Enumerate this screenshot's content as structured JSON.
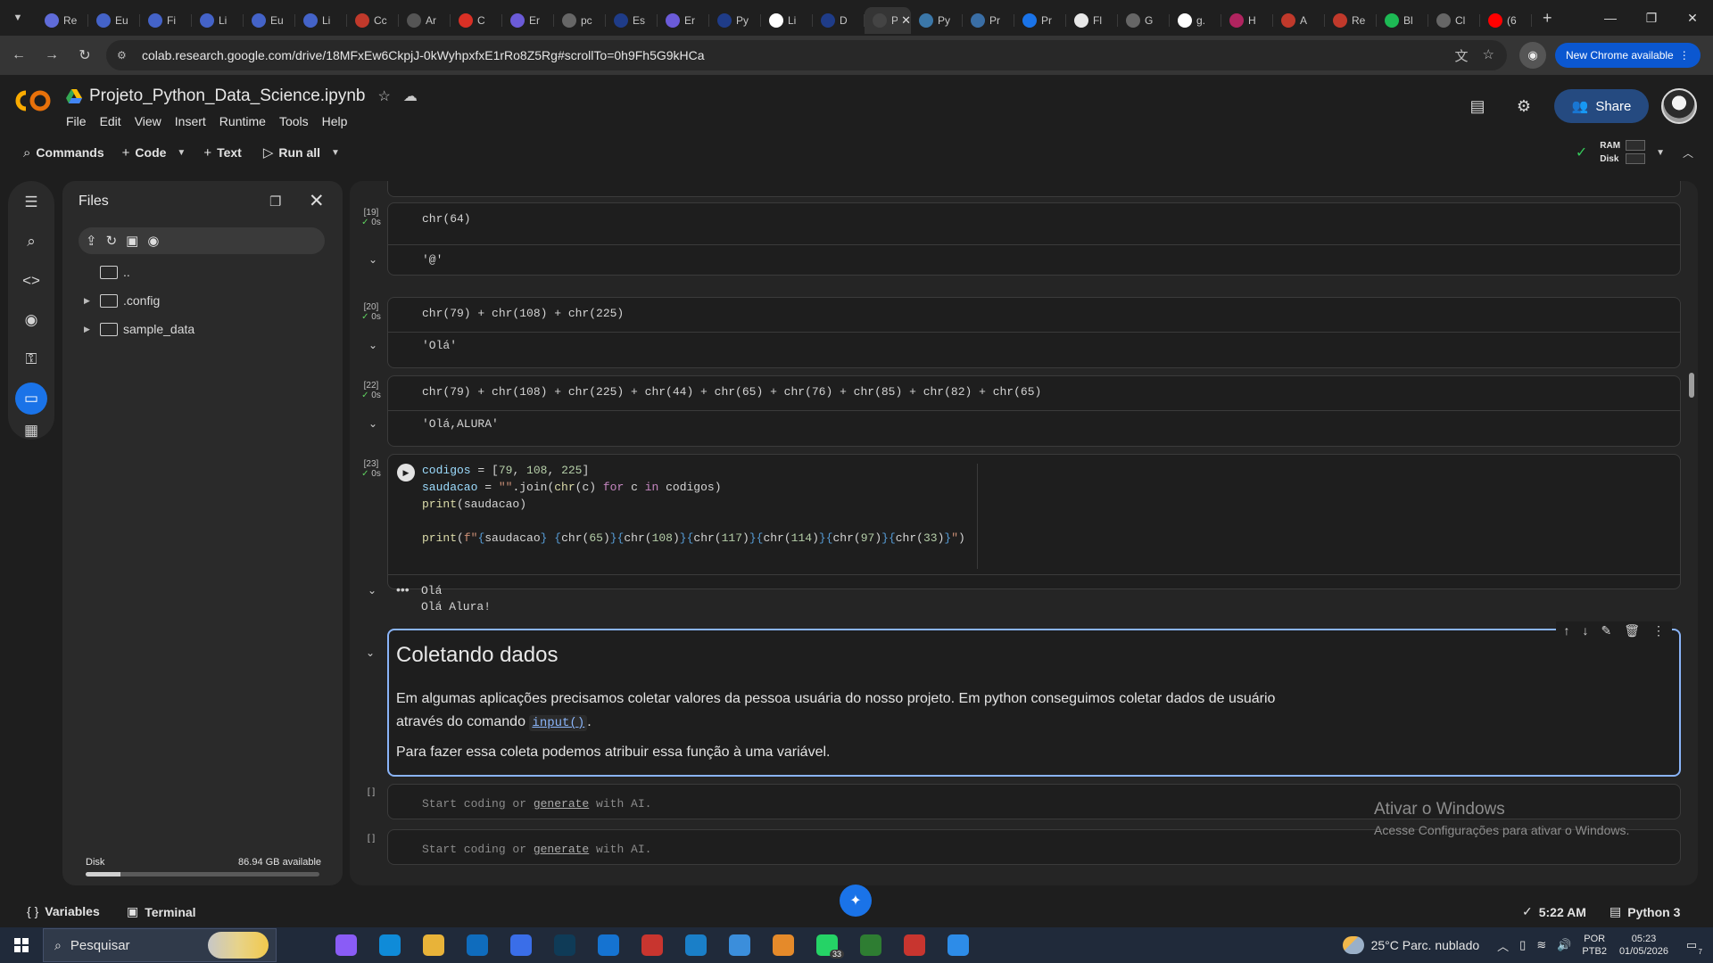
{
  "browser": {
    "tabs": [
      {
        "favicon": "colab-icon",
        "label": "Re",
        "color": "#5f6bd8"
      },
      {
        "favicon": "globe-icon",
        "label": "Eu",
        "color": "#4463c8"
      },
      {
        "favicon": "globe-icon",
        "label": "Fi",
        "color": "#4463c8"
      },
      {
        "favicon": "globe-icon",
        "label": "Li",
        "color": "#4463c8"
      },
      {
        "favicon": "globe-icon",
        "label": "Eu",
        "color": "#4463c8"
      },
      {
        "favicon": "globe-icon",
        "label": "Li",
        "color": "#4463c8"
      },
      {
        "favicon": "red-circle-icon",
        "label": "Cc",
        "color": "#c0392b"
      },
      {
        "favicon": "github-icon",
        "label": "Ar",
        "color": "#555555"
      },
      {
        "favicon": "gmail-icon",
        "label": "C",
        "color": "#d93025"
      },
      {
        "favicon": "globe-icon",
        "label": "Er",
        "color": "#6b5bd8"
      },
      {
        "favicon": "heart-icon",
        "label": "pc",
        "color": "#666666"
      },
      {
        "favicon": "alura-icon",
        "label": "Es",
        "color": "#1f3c88"
      },
      {
        "favicon": "globe-icon",
        "label": "Er",
        "color": "#6b5bd8"
      },
      {
        "favicon": "alura-icon",
        "label": "Py",
        "color": "#1f3c88"
      },
      {
        "favicon": "wikipedia-icon",
        "label": "Li",
        "color": "#ffffff"
      },
      {
        "favicon": "alura-icon",
        "label": "D",
        "color": "#1f3c88"
      },
      {
        "favicon": "colab-icon",
        "label": "Pr",
        "color": "#444444",
        "active": true
      },
      {
        "favicon": "python-icon",
        "label": "Py",
        "color": "#3b77a8"
      },
      {
        "favicon": "globe-icon",
        "label": "Pr",
        "color": "#3a6ea5"
      },
      {
        "favicon": "play-icon",
        "label": "Pr",
        "color": "#1a73e8"
      },
      {
        "favicon": "doc-icon",
        "label": "Fl",
        "color": "#e8e8e8"
      },
      {
        "favicon": "globe-icon",
        "label": "G",
        "color": "#666666"
      },
      {
        "favicon": "google-icon",
        "label": "g.",
        "color": "#ffffff"
      },
      {
        "favicon": "red-circle-icon",
        "label": "H",
        "color": "#b0245f"
      },
      {
        "favicon": "red-circle-icon",
        "label": "A",
        "color": "#c0392b"
      },
      {
        "favicon": "red-circle-icon",
        "label": "Re",
        "color": "#c0392b"
      },
      {
        "favicon": "spotify-icon",
        "label": "Bl",
        "color": "#1db954"
      },
      {
        "favicon": "globe-icon",
        "label": "Cl",
        "color": "#666666"
      },
      {
        "favicon": "youtube-icon",
        "label": "(6",
        "color": "#ff0000"
      }
    ],
    "active_tab_close": "✕",
    "new_tab": "+",
    "url": "colab.research.google.com/drive/18MFxEw6CkpjJ-0kWyhpxfxE1rRo8Z5Rg#scrollTo=0h9Fh5G9kHCa",
    "new_chrome_label": "New Chrome available"
  },
  "colab": {
    "notebook_title": "Projeto_Python_Data_Science.ipynb",
    "menu": [
      "File",
      "Edit",
      "View",
      "Insert",
      "Runtime",
      "Tools",
      "Help"
    ],
    "share_label": "Share",
    "toolbar": {
      "commands": "Commands",
      "code": "Code",
      "text": "Text",
      "run_all": "Run all"
    },
    "runtime": {
      "ram": "RAM",
      "disk": "Disk"
    }
  },
  "files_panel": {
    "title": "Files",
    "tree": [
      {
        "name": "..",
        "expandable": false
      },
      {
        "name": ".config",
        "expandable": true
      },
      {
        "name": "sample_data",
        "expandable": true
      }
    ],
    "disk_label": "Disk",
    "disk_available": "86.94 GB available",
    "disk_used_fraction": 0.15
  },
  "cells": [
    {
      "count": "[19]",
      "time": "0s",
      "code": "chr(64)",
      "output": "'@'"
    },
    {
      "count": "[20]",
      "time": "0s",
      "code": "chr(79) + chr(108) + chr(225)",
      "output": "'Olá'"
    },
    {
      "count": "[22]",
      "time": "0s",
      "code": "chr(79) + chr(108) + chr(225) + chr(44) + chr(65) + chr(76) + chr(85) + chr(82) + chr(65)",
      "output": "'Olá,ALURA'"
    },
    {
      "count": "[23]",
      "time": "0s",
      "code_lines": [
        "codigos = [79, 108, 225]",
        "saudacao = \"\".join(chr(c) for c in codigos)",
        "print(saudacao)",
        "",
        "print(f\"{saudacao} {chr(65)}{chr(108)}{chr(117)}{chr(114)}{chr(97)}{chr(33)}\")"
      ],
      "output_lines": [
        "Olá",
        "Olá Alura!"
      ]
    }
  ],
  "text_cell": {
    "heading": "Coletando dados",
    "p1_line1": "Em algumas aplicações precisamos coletar valores da pessoa usuária do nosso projeto. Em python conseguimos coletar dados de usuário",
    "p1_line2_prefix": "através do comando ",
    "p1_code": "input()",
    "p1_line2_suffix": ".",
    "p2": "Para fazer essa coleta podemos atribuir essa função à uma variável."
  },
  "empty_cells": [
    {
      "count": "[ ]",
      "hint_prefix": "Start coding or ",
      "hint_link": "generate",
      "hint_suffix": " with AI."
    },
    {
      "count": "[ ]",
      "hint_prefix": "Start coding or ",
      "hint_link": "generate",
      "hint_suffix": " with AI."
    }
  ],
  "watermark": {
    "title": "Ativar o Windows",
    "subtitle": "Acesse Configurações para ativar o Windows."
  },
  "statusbar": {
    "variables": "Variables",
    "terminal": "Terminal",
    "time": "5:22 AM",
    "kernel": "Python 3"
  },
  "taskbar": {
    "search_placeholder": "Pesquisar",
    "apps": [
      {
        "icon": "task-view-icon",
        "color": "#202a3a",
        "label": ""
      },
      {
        "icon": "copilot-icon",
        "color": "#8a5cf6",
        "label": ""
      },
      {
        "icon": "edge-icon",
        "color": "#0f8bd8",
        "label": ""
      },
      {
        "icon": "file-explorer-icon",
        "color": "#e8b339",
        "label": ""
      },
      {
        "icon": "outlook-icon",
        "color": "#0f6cbd",
        "label": ""
      },
      {
        "icon": "store-icon",
        "color": "#3a6ee8",
        "label": ""
      },
      {
        "icon": "prime-video-icon",
        "color": "#0f3b57",
        "label": ""
      },
      {
        "icon": "monitor-icon",
        "color": "#1573d1",
        "label": ""
      },
      {
        "icon": "chrome-icon",
        "color": "#c8352f",
        "label": ""
      },
      {
        "icon": "notepad-icon",
        "color": "#1a7fc8",
        "label": ""
      },
      {
        "icon": "globe-app-icon",
        "color": "#3b8edb",
        "label": ""
      },
      {
        "icon": "circle-app-icon",
        "color": "#e58a2a",
        "label": ""
      },
      {
        "icon": "whatsapp-icon",
        "color": "#25d366",
        "label": "",
        "badge": "33"
      },
      {
        "icon": "chrome-profile-icon",
        "color": "#2e7d32",
        "label": ""
      },
      {
        "icon": "chrome-profile-2-icon",
        "color": "#c8352f",
        "label": ""
      },
      {
        "icon": "photos-icon",
        "color": "#2d8ce8",
        "label": ""
      }
    ],
    "weather": "25°C  Parc. nublado",
    "lang_line1": "POR",
    "lang_line2": "PTB2",
    "clock_time": "05:23",
    "clock_date": "01/05/2026",
    "notif_count": "7"
  }
}
